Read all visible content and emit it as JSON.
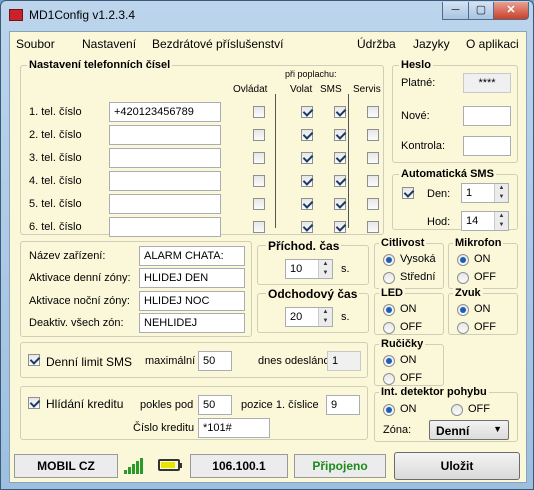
{
  "window": {
    "title": "MD1Config v1.2.3.4",
    "min": "─",
    "max": "▢",
    "close": "✕"
  },
  "menu": [
    "Soubor",
    "Nastavení",
    "Bezdrátové příslušenství",
    "Údržba",
    "Jazyky",
    "O aplikaci"
  ],
  "phones": {
    "title": "Nastavení telefonních čísel",
    "alarm_caption": "při poplachu:",
    "col_headers": [
      "Ovládat",
      "Volat",
      "SMS",
      "Servis"
    ],
    "rows": [
      {
        "label": "1. tel. číslo",
        "value": "+420123456789",
        "checks": [
          false,
          true,
          true,
          false
        ]
      },
      {
        "label": "2. tel. číslo",
        "value": "",
        "checks": [
          false,
          true,
          true,
          false
        ]
      },
      {
        "label": "3. tel. číslo",
        "value": "",
        "checks": [
          false,
          true,
          true,
          false
        ]
      },
      {
        "label": "4. tel. číslo",
        "value": "",
        "checks": [
          false,
          true,
          true,
          false
        ]
      },
      {
        "label": "5. tel. číslo",
        "value": "",
        "checks": [
          false,
          true,
          true,
          false
        ]
      },
      {
        "label": "6. tel. číslo",
        "value": "",
        "checks": [
          false,
          true,
          true,
          false
        ]
      }
    ]
  },
  "password": {
    "title": "Heslo",
    "current_label": "Platné:",
    "current_value": "****",
    "new_label": "Nové:",
    "confirm_label": "Kontrola:"
  },
  "auto_sms": {
    "title": "Automatická SMS",
    "day_label": "Den:",
    "day_value": "1",
    "hour_label": "Hod:",
    "hour_value": "14",
    "enabled": true
  },
  "device": {
    "name_label": "Název zařízení:",
    "name_value": "ALARM CHATA:",
    "day_zone_label": "Aktivace denní zóny:",
    "day_zone_value": "HLIDEJ DEN",
    "night_zone_label": "Aktivace noční zóny:",
    "night_zone_value": "HLIDEJ NOC",
    "deact_label": "Deaktiv. všech zón:",
    "deact_value": "NEHLIDEJ"
  },
  "entry_delay": {
    "title": "Příchod. čas",
    "value": "10",
    "unit": "s."
  },
  "exit_delay": {
    "title": "Odchodový čas",
    "value": "20",
    "unit": "s."
  },
  "sensitivity": {
    "title": "Citlivost",
    "options": [
      "Vysoká",
      "Střední"
    ],
    "selected": 0
  },
  "microphone": {
    "title": "Mikrofon",
    "options": [
      "ON",
      "OFF"
    ],
    "selected": 0
  },
  "led": {
    "title": "LED",
    "options": [
      "ON",
      "OFF"
    ],
    "selected": 0
  },
  "sound": {
    "title": "Zvuk",
    "options": [
      "ON",
      "OFF"
    ],
    "selected": 0
  },
  "hands": {
    "title": "Ručičky",
    "options": [
      "ON",
      "OFF"
    ],
    "selected": 0
  },
  "sms_limit": {
    "label": "Denní limit SMS",
    "enabled": true,
    "max_label": "maximální",
    "max_value": "50",
    "sent_label": "dnes odesláno",
    "sent_value": "1"
  },
  "credit": {
    "label": "Hlídání kreditu",
    "enabled": true,
    "below_label": "pokles pod",
    "below_value": "50",
    "pos_label": "pozice 1. číslice",
    "pos_value": "9",
    "number_label": "Číslo kreditu",
    "number_value": "*101#"
  },
  "motion": {
    "title": "Int. detektor pohybu",
    "options": [
      "ON",
      "OFF"
    ],
    "selected": 0,
    "zone_label": "Zóna:",
    "zone_value": "Denní"
  },
  "status": {
    "operator": "MOBIL CZ",
    "version": "106.100.1",
    "connection": "Připojeno",
    "save": "Uložit"
  },
  "colors": {
    "connected": "#1c8a1c",
    "battery": "#e6e600",
    "signal": "#2a9a2a"
  },
  "icons": {
    "window": "app-icon",
    "signal": "signal-icon",
    "battery": "battery-icon"
  }
}
